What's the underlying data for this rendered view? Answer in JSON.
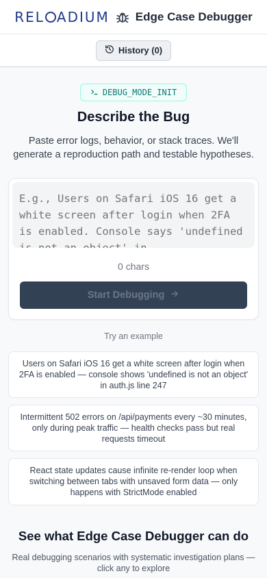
{
  "header": {
    "logo_text_left": "REL",
    "logo_text_right": "ADIUM",
    "logo_full": "RELOADIUM",
    "app_title": "Edge Case Debugger"
  },
  "history": {
    "label": "History (0)"
  },
  "tag": {
    "label": "DEBUG_MODE_INIT"
  },
  "main": {
    "heading": "Describe the Bug",
    "subheading": "Paste error logs, behavior, or stack traces. We'll generate a reproduction path and testable hypotheses.",
    "placeholder": "E.g., Users on Safari iOS 16 get a white screen after login when 2FA is enabled. Console says 'undefined is not an object' in",
    "char_count": "0 chars",
    "start_label": "Start Debugging"
  },
  "examples": {
    "title": "Try an example",
    "items": [
      "Users on Safari iOS 16 get a white screen after login when 2FA is enabled — console shows 'undefined is not an object' in auth.js line 247",
      "Intermittent 502 errors on /api/payments every ~30 minutes, only during peak traffic — health checks pass but real requests timeout",
      "React state updates cause infinite re-render loop when switching between tabs with unsaved form data — only happens with StrictMode enabled"
    ]
  },
  "showcase": {
    "title": "See what Edge Case Debugger can do",
    "subtitle": "Real debugging scenarios with systematic investigation plans — click any to explore"
  },
  "colors": {
    "brand": "#1e3a8a",
    "button": "#334155",
    "tag_accent": "#0f766e"
  }
}
